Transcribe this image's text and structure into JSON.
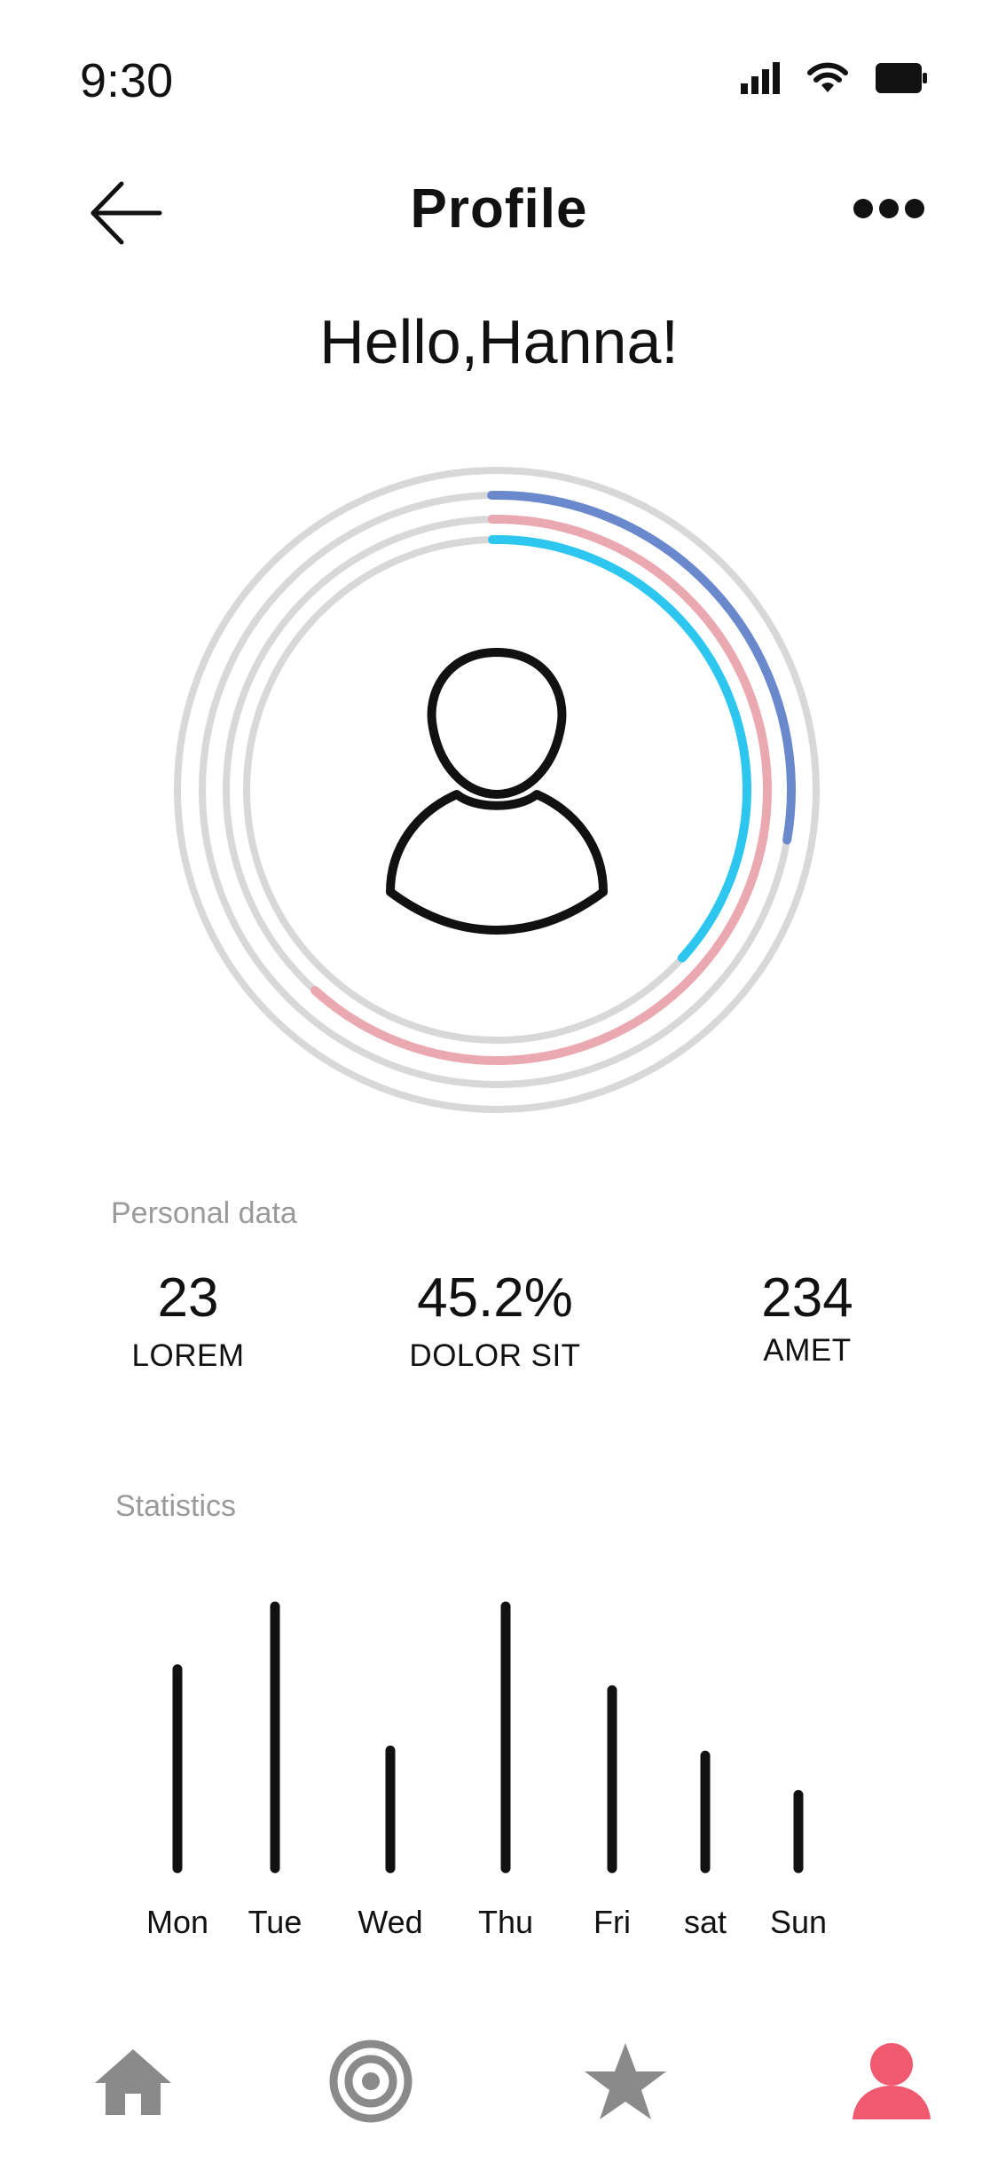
{
  "status_bar": {
    "time": "9:30"
  },
  "header": {
    "title": "Profile"
  },
  "greeting": "Hello,Hanna!",
  "rings": [
    {
      "name": "outer",
      "progress": 0.28,
      "color": "#6a88cc"
    },
    {
      "name": "middle",
      "progress": 0.62,
      "color": "#eaa9b1"
    },
    {
      "name": "inner",
      "progress": 0.37,
      "color": "#2cc6ee"
    }
  ],
  "personal_data": {
    "label": "Personal data",
    "stats": [
      {
        "value": "23",
        "caption": "LOREM"
      },
      {
        "value": "45.2%",
        "caption": "DOLOR SIT"
      },
      {
        "value": "234",
        "caption": "AMET"
      }
    ]
  },
  "statistics": {
    "label": "Statistics"
  },
  "chart_data": {
    "type": "bar",
    "categories": [
      "Mon",
      "Tue",
      "Wed",
      "Thu",
      "Fri",
      "sat",
      "Sun"
    ],
    "values": [
      76,
      100,
      45,
      100,
      68,
      43,
      28
    ],
    "ylim": [
      0,
      100
    ],
    "grid": false
  },
  "nav": [
    {
      "icon": "home-icon",
      "active": false
    },
    {
      "icon": "target-icon",
      "active": false
    },
    {
      "icon": "star-icon",
      "active": false
    },
    {
      "icon": "profile-icon",
      "active": true
    }
  ],
  "colors": {
    "nav_inactive": "#8a8a8a",
    "nav_active": "#f05a70",
    "track": "#d8d8d8"
  }
}
